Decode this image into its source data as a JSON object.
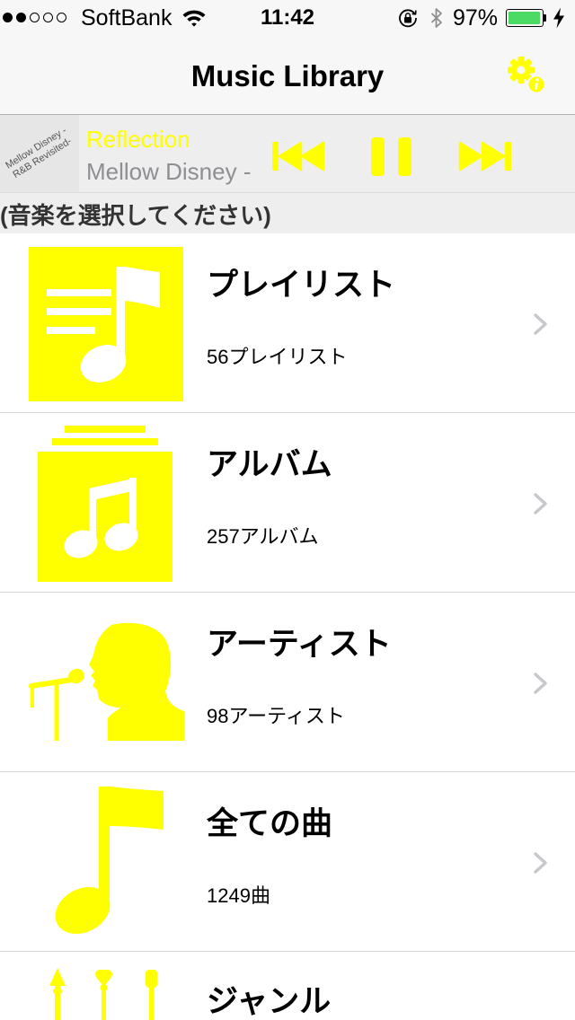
{
  "status_bar": {
    "signal_strength": 2,
    "signal_max": 5,
    "carrier": "SoftBank",
    "time": "11:42",
    "battery_label": "97%",
    "battery_level": 0.97,
    "icons": {
      "wifi": "wifi-icon",
      "rotation_lock": "rotation-lock-icon",
      "bluetooth": "bluetooth-icon",
      "battery": "battery-icon",
      "charging": "charging-bolt-icon"
    }
  },
  "nav_bar": {
    "title": "Music Library",
    "settings_icon": "gear-info-icon"
  },
  "now_playing": {
    "artwork_lines": [
      "Mellow Disney -",
      "R&B Revisited-"
    ],
    "track_title": "Reflection",
    "album": "Mellow Disney -",
    "previous_icon": "previous-track-icon",
    "pause_icon": "pause-icon",
    "next_icon": "next-track-icon"
  },
  "section_header": "(音楽を選択してください)",
  "categories": [
    {
      "title": "プレイリスト",
      "count": "56プレイリスト",
      "icon": "playlist-icon"
    },
    {
      "title": "アルバム",
      "count": "257アルバム",
      "icon": "album-icon"
    },
    {
      "title": "アーティスト",
      "count": "98アーティスト",
      "icon": "artist-icon"
    },
    {
      "title": "全ての曲",
      "count": "1249曲",
      "icon": "song-icon"
    },
    {
      "title": "ジャンル",
      "icon": "genre-icon"
    }
  ],
  "colors": {
    "accent": "#FFFF00",
    "bar_background": "#F7F7F7",
    "header_background": "#EEEEEE",
    "secondary_text": "#8E8E93",
    "chevron": "#C7C7CC",
    "battery_fill": "#4CD964",
    "separator": "#D9D9D9"
  }
}
